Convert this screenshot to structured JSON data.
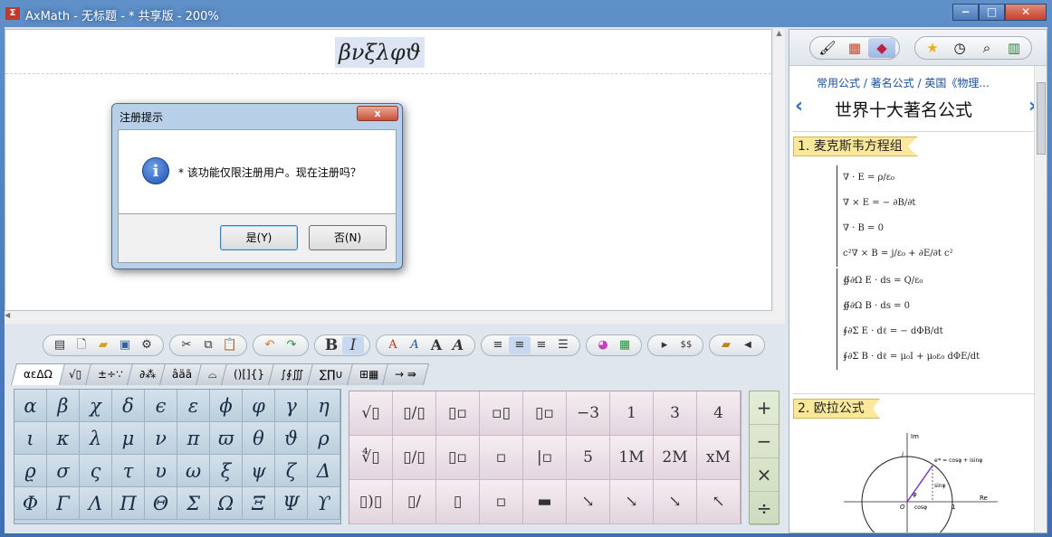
{
  "window": {
    "title": "AxMath - 无标题 - * 共享版 - 200%",
    "controls": [
      "−",
      "□",
      "✕"
    ]
  },
  "editor": {
    "formula": "βνξλφϑ"
  },
  "dialog": {
    "title": "注册提示",
    "close": "x",
    "message": "* 该功能仅限注册用户。现在注册吗？",
    "yes": "是(Y)",
    "no": "否(N)",
    "icon": "i"
  },
  "toolbar": {
    "bold": "B",
    "italic": "I",
    "styles": [
      "A",
      "A",
      "A",
      "A"
    ],
    "sizes": [
      "A"
    ]
  },
  "tabs": [
    "αεΔΩ",
    "√▯",
    "±÷∵",
    "∂⁂",
    "âäã",
    "⌓",
    "()[]{}",
    "∫∮∭",
    "∑∏∪",
    "⊞▦",
    "→ ⇛"
  ],
  "greek": [
    [
      "α",
      "β",
      "χ",
      "δ",
      "ϵ",
      "ε",
      "ϕ",
      "φ",
      "γ",
      "η"
    ],
    [
      "ι",
      "κ",
      "λ",
      "μ",
      "ν",
      "π",
      "ϖ",
      "θ",
      "ϑ",
      "ρ"
    ],
    [
      "ϱ",
      "σ",
      "ς",
      "τ",
      "υ",
      "ω",
      "ξ",
      "ψ",
      "ζ",
      "Δ"
    ],
    [
      "Φ",
      "Γ",
      "Λ",
      "Π",
      "Θ",
      "Σ",
      "Ω",
      "Ξ",
      "Ψ",
      "ϒ"
    ]
  ],
  "templates": {
    "row1": [
      "√▯",
      "▯/▯",
      "▯▫",
      "▫▯",
      "▯▫",
      "−3",
      "1",
      "3",
      "4"
    ],
    "row2": [
      "∜▯",
      "▯/▯",
      "▯▫",
      "▫",
      "|▫",
      "5",
      "1M",
      "2M",
      "xM"
    ],
    "row3": [
      "▯)▯",
      "▯/",
      "▯",
      "▫",
      "▬",
      "↘",
      "↘",
      "↘",
      "↖"
    ]
  },
  "operators": [
    "+",
    "−",
    "×",
    "÷"
  ],
  "right_pane": {
    "breadcrumb": "常用公式 / 著名公式 / 英国《物理...",
    "title": "世界十大著名公式",
    "section1": "1. 麦克斯韦方程组",
    "section2": "2. 欧拉公式",
    "maxwell_a": [
      "∇ · E = ρ/ε₀",
      "∇ × E = − ∂B/∂t",
      "∇ · B = 0",
      "c²∇ × B = j/ε₀ + ∂E/∂t c²"
    ],
    "maxwell_b": [
      "∯∂Ω E · ds = Q/ε₀",
      "∯∂Ω B · ds = 0",
      "∮∂Σ E · dℓ = − dΦB/dt",
      "∮∂Σ B · dℓ = μ₀I + μ₀ε₀ dΦE/dt"
    ],
    "euler": {
      "im": "Im",
      "re": "Re",
      "eq": "eⁱᵠ = cosφ + isinφ",
      "sin": "sinφ",
      "cos": "cosφ",
      "o": "O",
      "one": "1",
      "i": "i",
      "phi": "φ"
    }
  }
}
